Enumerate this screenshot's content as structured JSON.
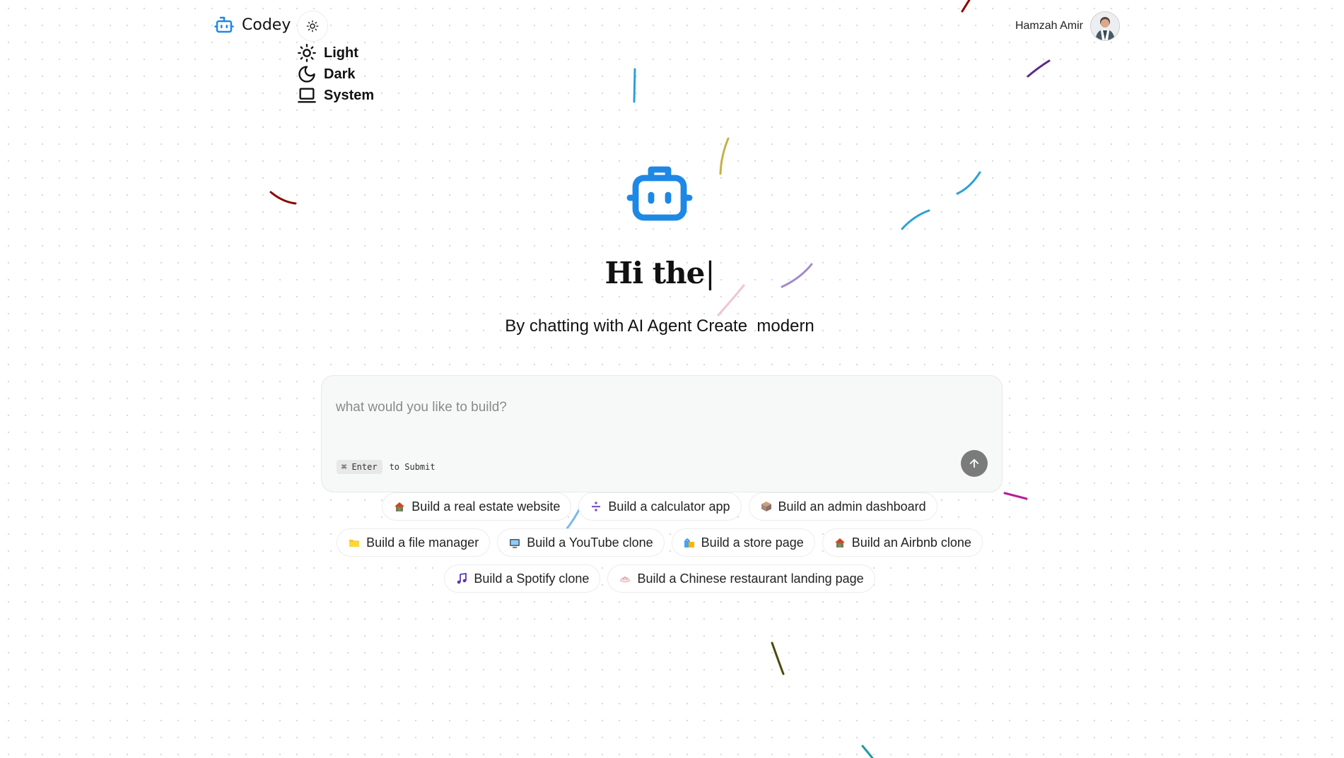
{
  "header": {
    "brand_name": "Codey",
    "brand_icon": "bot-icon",
    "theme_toggle_icon": "sun-icon",
    "theme_menu": [
      {
        "label": "Light",
        "icon": "sun-icon"
      },
      {
        "label": "Dark",
        "icon": "moon-icon"
      },
      {
        "label": "System",
        "icon": "laptop-icon"
      }
    ],
    "user_name": "Hamzah Amir"
  },
  "hero": {
    "icon": "bot-icon",
    "title": "Hi the",
    "subtitle": "By chatting with AI Agent Create  modern"
  },
  "prompt": {
    "placeholder": "what would you like to build?",
    "value": "",
    "shortcut_key": "⌘ Enter",
    "shortcut_text": "to Submit",
    "send_icon": "arrow-up-icon"
  },
  "suggestions": {
    "rows": [
      [
        {
          "label": "Build a real estate website",
          "icon": "house-icon"
        },
        {
          "label": "Build a calculator app",
          "icon": "divide-icon"
        },
        {
          "label": "Build an admin dashboard",
          "icon": "package-icon"
        }
      ],
      [
        {
          "label": "Build a file manager",
          "icon": "folder-icon"
        },
        {
          "label": "Build a YouTube clone",
          "icon": "tv-icon"
        },
        {
          "label": "Build a store page",
          "icon": "shopping-bags-icon"
        },
        {
          "label": "Build an Airbnb clone",
          "icon": "house-icon"
        }
      ],
      [
        {
          "label": "Build a Spotify clone",
          "icon": "music-note-icon"
        },
        {
          "label": "Build a Chinese restaurant landing page",
          "icon": "dumpling-icon"
        }
      ]
    ]
  },
  "colors": {
    "accent": "#1e88e5",
    "send_button": "#7b7b7b",
    "input_background": "#f7f8f8"
  }
}
